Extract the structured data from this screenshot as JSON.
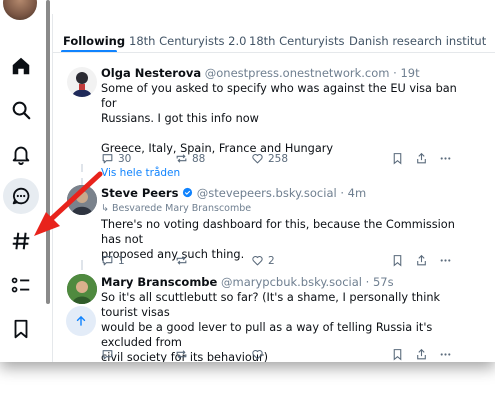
{
  "tabs": [
    {
      "label": "Following",
      "active": true
    },
    {
      "label": "18th Centuryists 2.0",
      "active": false
    },
    {
      "label": "18th Centuryists",
      "active": false
    },
    {
      "label": "Danish research institut",
      "active": false
    }
  ],
  "sidebar": {
    "icons": [
      "home-icon",
      "search-icon",
      "notifications-bell-icon",
      "chat-icon",
      "feeds-hashtag-icon",
      "lists-icon",
      "bookmark-icon"
    ],
    "active": "chat-icon"
  },
  "posts": [
    {
      "name": "Olga Nesterova",
      "handle": "@onestpress.onestnetwork.com",
      "sep": " · ",
      "time": "19t",
      "text_lines": [
        "Some of you asked to specify who was against the EU visa ban for",
        "Russians. I got this info now",
        "",
        "Greece, Italy, Spain, France and Hungary"
      ],
      "replies": "30",
      "reposts": "88",
      "likes": "258"
    },
    {
      "show_thread": "Vis hele tråden",
      "name": "Steve Peers",
      "verified": true,
      "handle": "@stevepeers.bsky.social",
      "sep": " · ",
      "time": "4m",
      "reply_to": "Besvarede Mary Branscombe",
      "text_lines": [
        "There's no voting dashboard for this, because the Commission has not",
        "proposed any such thing."
      ],
      "replies": "1",
      "reposts": "",
      "likes": "2"
    },
    {
      "name": "Mary Branscombe",
      "handle": "@marypcbuk.bsky.social",
      "sep": " · ",
      "time": "57s",
      "text_lines": [
        "So it's all scuttlebutt so far? (It's a shame, I personally think tourist visas",
        "would be a good lever to pull as a way of telling Russia it's excluded from",
        "civil society for its behaviour)"
      ],
      "replies": "",
      "reposts": "",
      "likes": ""
    }
  ],
  "colors": {
    "accent": "#1083fe",
    "annotation_arrow": "#e8231c"
  }
}
